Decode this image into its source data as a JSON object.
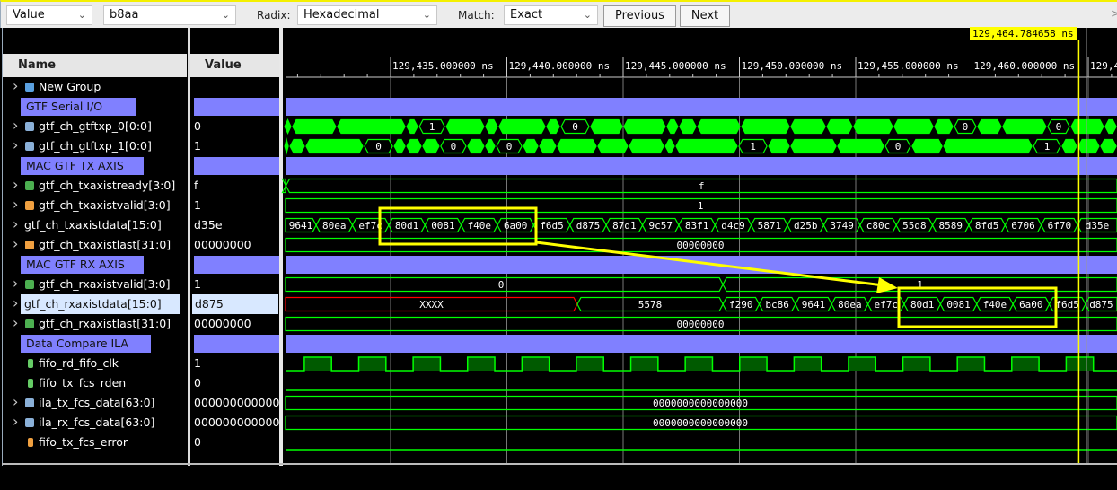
{
  "toolbar": {
    "find_by": "Value",
    "search_value": "b8aa",
    "radix_label": "Radix:",
    "radix": "Hexadecimal",
    "match_label": "Match:",
    "match": "Exact",
    "previous": "Previous",
    "next": "Next",
    "more": ">"
  },
  "columns": {
    "name": "Name",
    "value": "Value"
  },
  "cursor": {
    "time_label": "129,464.784658 ns",
    "time_ns": 129464.784658
  },
  "timeline": {
    "unit": "ns",
    "ticks": [
      {
        "t": 129435,
        "label": "129,435.000000 ns"
      },
      {
        "t": 129440,
        "label": "129,440.000000 ns"
      },
      {
        "t": 129445,
        "label": "129,445.000000 ns"
      },
      {
        "t": 129450,
        "label": "129,450.000000 ns"
      },
      {
        "t": 129455,
        "label": "129,455.000000 ns"
      },
      {
        "t": 129460,
        "label": "129,460.000000 ns"
      },
      {
        "t": 129465,
        "label": "129,4"
      }
    ],
    "view_start_ns": 129430.41,
    "view_end_ns": 129466.24
  },
  "colors": {
    "wave": "#00ff00",
    "undefined": "#ff0000",
    "divider": "#8080ff",
    "cursor": "#ffff00",
    "highlight": "#ffff00"
  },
  "signals": [
    {
      "name": "New Group",
      "kind": "group",
      "icon": "group-icon",
      "icolor": "#5aa0e0",
      "value": "",
      "expand": true,
      "wave": {
        "type": "none"
      }
    },
    {
      "name": "GTF Serial I/O",
      "kind": "divider",
      "wave": {
        "type": "divider"
      }
    },
    {
      "name": "gtf_ch_gtftxp_0[0:0]",
      "icon": "bus-icon",
      "icolor": "#8ab0d8",
      "value": "0",
      "expand": true,
      "wave": {
        "type": "toggle",
        "transitions": [
          129430.41,
          129430.75,
          129432.68,
          129435.66,
          129436.2,
          129437.36,
          129439.05,
          129439.63,
          129441.68,
          129442.3,
          129443.57,
          129445.0,
          129446.85,
          129447.39,
          129448.17,
          129450.06,
          129452.18,
          129453.73,
          129454.88,
          129456.62,
          129458.36,
          129459.21,
          129460.21,
          129461.29,
          129463.22,
          129464.23,
          129465.69,
          129466.24
        ],
        "labels": {
          "4": "1",
          "9": "0",
          "21": "0",
          "24": "0"
        }
      }
    },
    {
      "name": "gtf_ch_gtftxp_1[0:0]",
      "icon": "bus-icon",
      "icolor": "#8ab0d8",
      "value": "1",
      "expand": true,
      "wave": {
        "type": "toggle",
        "transitions": [
          129430.41,
          129430.64,
          129431.33,
          129433.84,
          129435.12,
          129435.66,
          129436.35,
          129437.12,
          129438.28,
          129439.05,
          129439.52,
          129440.68,
          129441.37,
          129442.14,
          129443.88,
          129445.23,
          129446.78,
          129447.24,
          129449.94,
          129451.22,
          129452.18,
          129454.19,
          129456.24,
          129457.39,
          129458.75,
          129462.61,
          129463.84,
          129464.54,
          129465.5,
          129466.24
        ],
        "labels": {
          "3": "0",
          "7": "0",
          "10": "0",
          "18": "1",
          "22": "0",
          "25": "1"
        }
      }
    },
    {
      "name": "MAC GTF TX AXIS",
      "kind": "divider",
      "wave": {
        "type": "divider"
      }
    },
    {
      "name": "gtf_ch_txaxistready[3:0]",
      "icon": "bus-icon",
      "icolor": "#4caf50",
      "value": "f",
      "expand": true,
      "wave": {
        "type": "bus",
        "segments": [
          {
            "start": 129430.41,
            "v": ""
          },
          {
            "start": 129430.5,
            "v": "f"
          }
        ]
      }
    },
    {
      "name": "gtf_ch_txaxistvalid[3:0]",
      "icon": "bus-icon",
      "icolor": "#f0a040",
      "value": "1",
      "expand": true,
      "wave": {
        "type": "bus",
        "segments": [
          {
            "start": 129430.41,
            "v": "1"
          }
        ]
      }
    },
    {
      "name": "gtf_ch_txaxistdata[15:0]",
      "value": "d35e",
      "expand": true,
      "wave": {
        "type": "beats",
        "first_ns": 129430.41,
        "beat_start_ns": 129431.8,
        "beat_ns": 1.559,
        "values": [
          "9641",
          "80ea",
          "ef7c",
          "80d1",
          "0081",
          "f40e",
          "6a00",
          "f6d5",
          "d875",
          "87d1",
          "9c57",
          "83f1",
          "d4c9",
          "5871",
          "d25b",
          "3749",
          "c80c",
          "55d8",
          "8589",
          "8fd5",
          "6706",
          "6f70",
          "d35e"
        ]
      }
    },
    {
      "name": "gtf_ch_txaxistlast[31:0]",
      "icon": "bus-icon",
      "icolor": "#f0a040",
      "value": "00000000",
      "expand": true,
      "wave": {
        "type": "bus",
        "segments": [
          {
            "start": 129430.41,
            "v": "00000000"
          }
        ]
      }
    },
    {
      "name": "MAC GTF RX AXIS",
      "kind": "divider",
      "wave": {
        "type": "divider"
      }
    },
    {
      "name": "gtf_ch_rxaxistvalid[3:0]",
      "icon": "bus-icon",
      "icolor": "#4caf50",
      "value": "1",
      "expand": true,
      "wave": {
        "type": "bus",
        "segments": [
          {
            "start": 129430.41,
            "v": "0"
          },
          {
            "start": 129449.29,
            "v": "1"
          }
        ]
      }
    },
    {
      "name": "gtf_ch_rxaxistdata[15:0]",
      "value": "d875",
      "expand": true,
      "selected": true,
      "wave": {
        "type": "rx",
        "undefined_until": 129443.03,
        "undefined_label": "XXXX",
        "hold": {
          "v": "5578",
          "until": 129449.29
        },
        "beat_ns": 1.559,
        "values": [
          "f290",
          "bc86",
          "9641",
          "80ea",
          "ef7c",
          "80d1",
          "0081",
          "f40e",
          "6a00",
          "f6d5",
          "d875"
        ]
      }
    },
    {
      "name": "gtf_ch_rxaxistlast[31:0]",
      "icon": "bus-icon",
      "icolor": "#4caf50",
      "value": "00000000",
      "expand": true,
      "wave": {
        "type": "bus",
        "segments": [
          {
            "start": 129430.41,
            "v": "00000000"
          }
        ]
      }
    },
    {
      "name": "Data Compare ILA",
      "kind": "divider",
      "wave": {
        "type": "divider"
      }
    },
    {
      "name": "fifo_rd_fifo_clk",
      "icon": "wire-icon",
      "icolor": "#6c6",
      "value": "1",
      "expand": false,
      "wave": {
        "type": "clock",
        "first_rise_ns": 129431.29,
        "period_ns": 2.34
      }
    },
    {
      "name": "fifo_tx_fcs_rden",
      "icon": "wire-icon",
      "icolor": "#6c6",
      "value": "0",
      "expand": false,
      "wave": {
        "type": "low"
      }
    },
    {
      "name": "ila_tx_fcs_data[63:0]",
      "icon": "bus-icon",
      "icolor": "#8ab0d8",
      "value": "0000000000000000",
      "expand": true,
      "wave": {
        "type": "bus",
        "segments": [
          {
            "start": 129430.41,
            "v": "0000000000000000"
          }
        ]
      }
    },
    {
      "name": "ila_rx_fcs_data[63:0]",
      "icon": "bus-icon",
      "icolor": "#8ab0d8",
      "value": "0000000000000000",
      "expand": true,
      "wave": {
        "type": "bus",
        "segments": [
          {
            "start": 129430.41,
            "v": "0000000000000000"
          }
        ]
      }
    },
    {
      "name": "fifo_tx_fcs_error",
      "icon": "wire-icon",
      "icolor": "#f0a040",
      "value": "0",
      "expand": false,
      "wave": {
        "type": "low"
      }
    }
  ]
}
